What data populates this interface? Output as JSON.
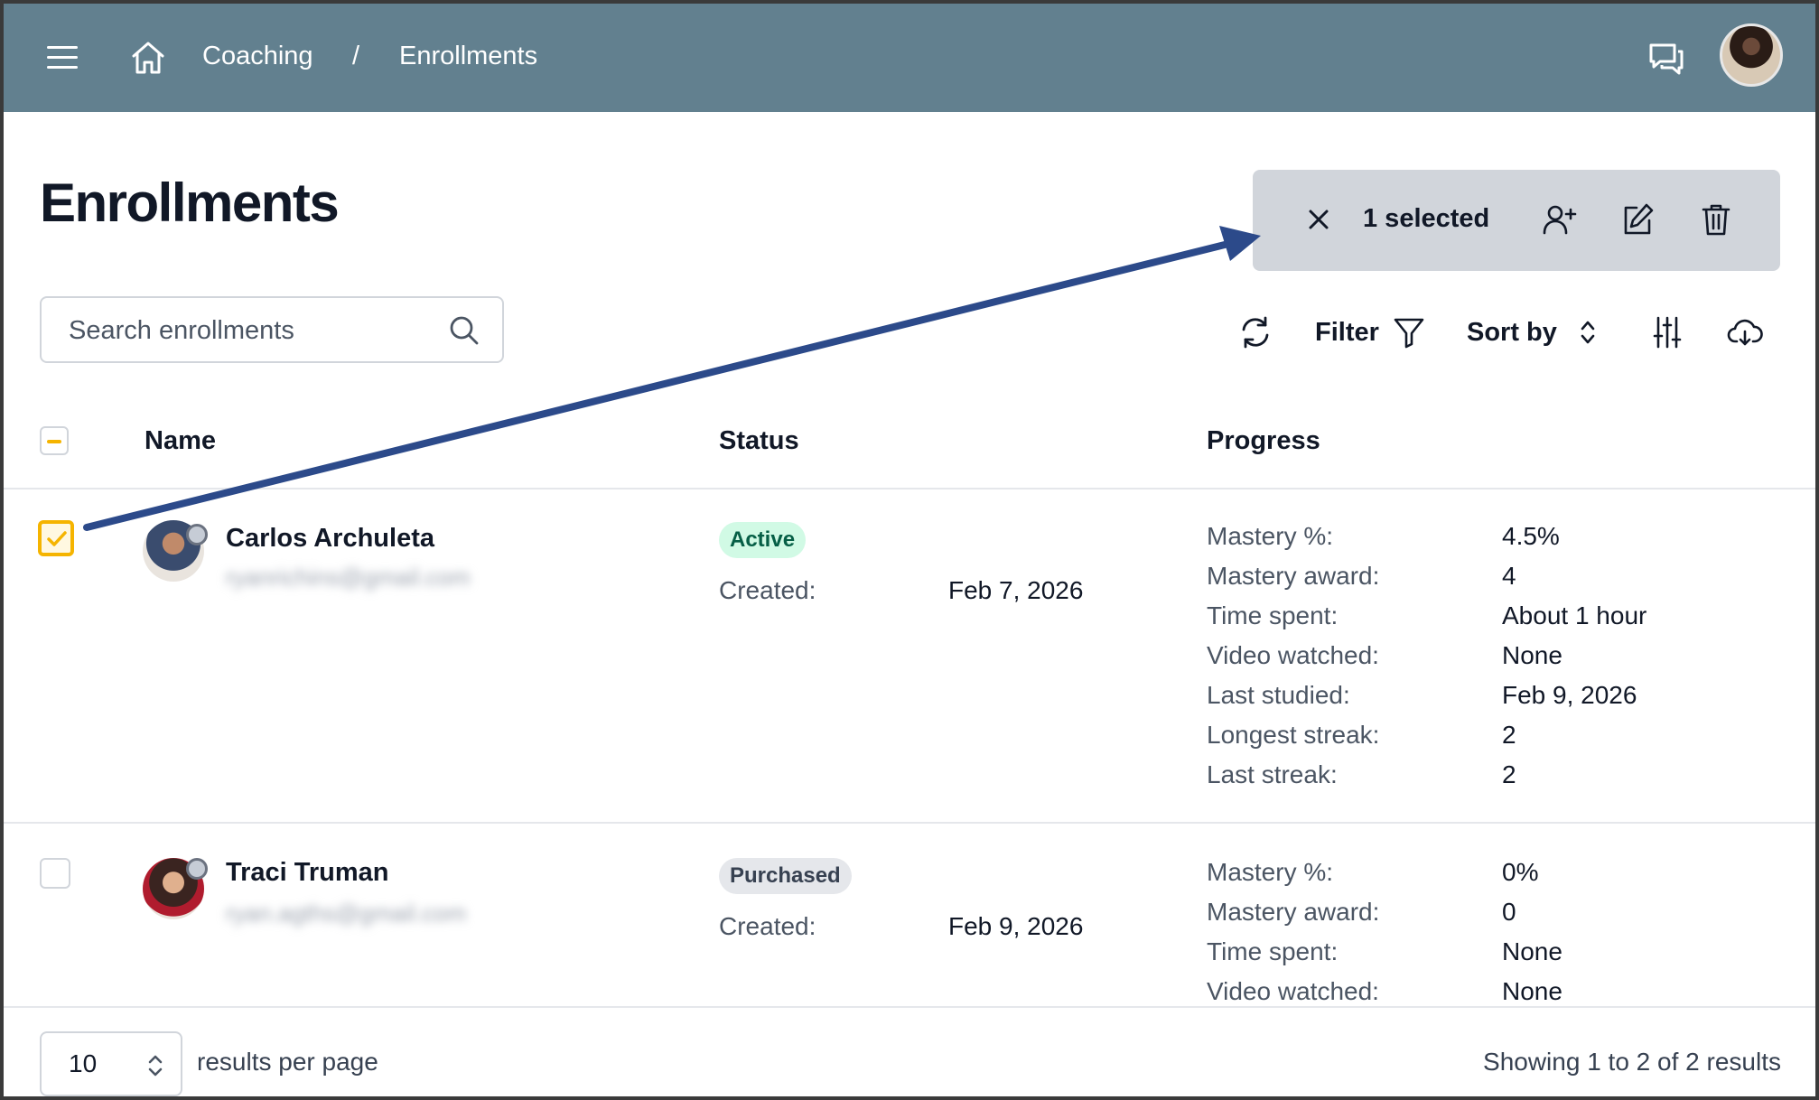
{
  "header": {
    "breadcrumb": [
      "Coaching",
      "Enrollments"
    ],
    "breadcrumb_separator": "/"
  },
  "page": {
    "title": "Enrollments"
  },
  "selection_bar": {
    "count_label": "1 selected"
  },
  "search": {
    "placeholder": "Search enrollments",
    "value": ""
  },
  "toolbar": {
    "filter_label": "Filter",
    "sort_label": "Sort by"
  },
  "table": {
    "columns": [
      "Name",
      "Status",
      "Progress"
    ],
    "rows": [
      {
        "selected": true,
        "name": "Carlos Archuleta",
        "email": "ryanrichins@gmail.com",
        "status": "Active",
        "created_label": "Created:",
        "created": "Feb 7, 2026",
        "metrics": [
          {
            "label": "Mastery %:",
            "value": "4.5%"
          },
          {
            "label": "Mastery award:",
            "value": "4"
          },
          {
            "label": "Time spent:",
            "value": "About 1 hour"
          },
          {
            "label": "Video watched:",
            "value": "None"
          },
          {
            "label": "Last studied:",
            "value": "Feb 9, 2026"
          },
          {
            "label": "Longest streak:",
            "value": "2"
          },
          {
            "label": "Last streak:",
            "value": "2"
          }
        ]
      },
      {
        "selected": false,
        "name": "Traci Truman",
        "email": "ryan.agths@gmail.com",
        "status": "Purchased",
        "created_label": "Created:",
        "created": "Feb 9, 2026",
        "metrics": [
          {
            "label": "Mastery %:",
            "value": "0%"
          },
          {
            "label": "Mastery award:",
            "value": "0"
          },
          {
            "label": "Time spent:",
            "value": "None"
          },
          {
            "label": "Video watched:",
            "value": "None"
          }
        ]
      }
    ]
  },
  "footer": {
    "per_page_value": "10",
    "per_page_label": "results per page",
    "showing_text": "Showing 1 to 2 of 2 results"
  },
  "colors": {
    "header_bg": "#62808f",
    "selection_bar_bg": "#d1d5db",
    "checkbox_accent": "#f5b400",
    "annotation_arrow": "#2c4a8a",
    "active_badge_bg": "#d1fae5"
  },
  "icons": {
    "menu": "menu-icon",
    "home": "home-icon",
    "chat": "chat-icon",
    "close": "close-icon",
    "add_user": "add-user-icon",
    "edit": "edit-icon",
    "delete": "trash-icon",
    "search": "search-icon",
    "refresh": "refresh-icon",
    "filter": "filter-icon",
    "sort": "sort-icon",
    "columns": "sliders-icon",
    "download": "cloud-download-icon"
  }
}
